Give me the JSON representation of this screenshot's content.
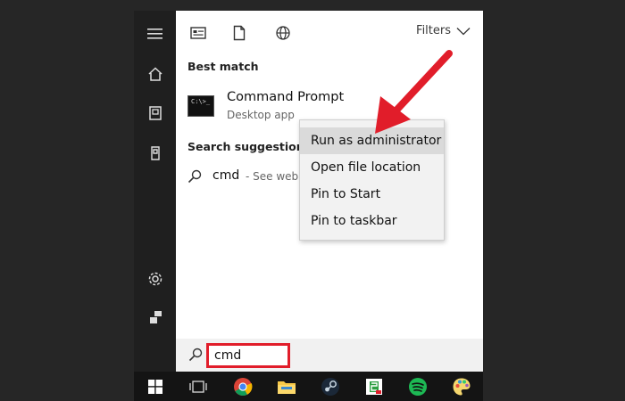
{
  "panel": {
    "filters_label": "Filters",
    "best_match_heading": "Best match",
    "result": {
      "title": "Command Prompt",
      "subtitle": "Desktop app",
      "icon_glyph": "C:\\>_"
    },
    "suggestions_heading": "Search suggestions",
    "suggestion": {
      "query": "cmd",
      "hint": "- See web r"
    }
  },
  "context_menu": {
    "items": [
      {
        "label": "Run as administrator",
        "highlighted": true
      },
      {
        "label": "Open file location",
        "highlighted": false
      },
      {
        "label": "Pin to Start",
        "highlighted": false
      },
      {
        "label": "Pin to taskbar",
        "highlighted": false
      }
    ]
  },
  "search": {
    "value": "cmd"
  },
  "rail": {
    "icons": [
      "hamburger-icon",
      "home-icon",
      "recent-documents-icon",
      "device-icon",
      "settings-icon",
      "user-icon"
    ]
  },
  "taskbar": {
    "icons": [
      "windows-start-icon",
      "task-view-icon",
      "chrome-icon",
      "file-explorer-icon",
      "steam-icon",
      "store-icon",
      "spotify-icon",
      "paint-icon"
    ]
  },
  "colors": {
    "highlight_red": "#e11d2a",
    "rail_bg": "#1f1f1f",
    "taskbar_bg": "#141414",
    "menu_highlight": "#dadada"
  }
}
